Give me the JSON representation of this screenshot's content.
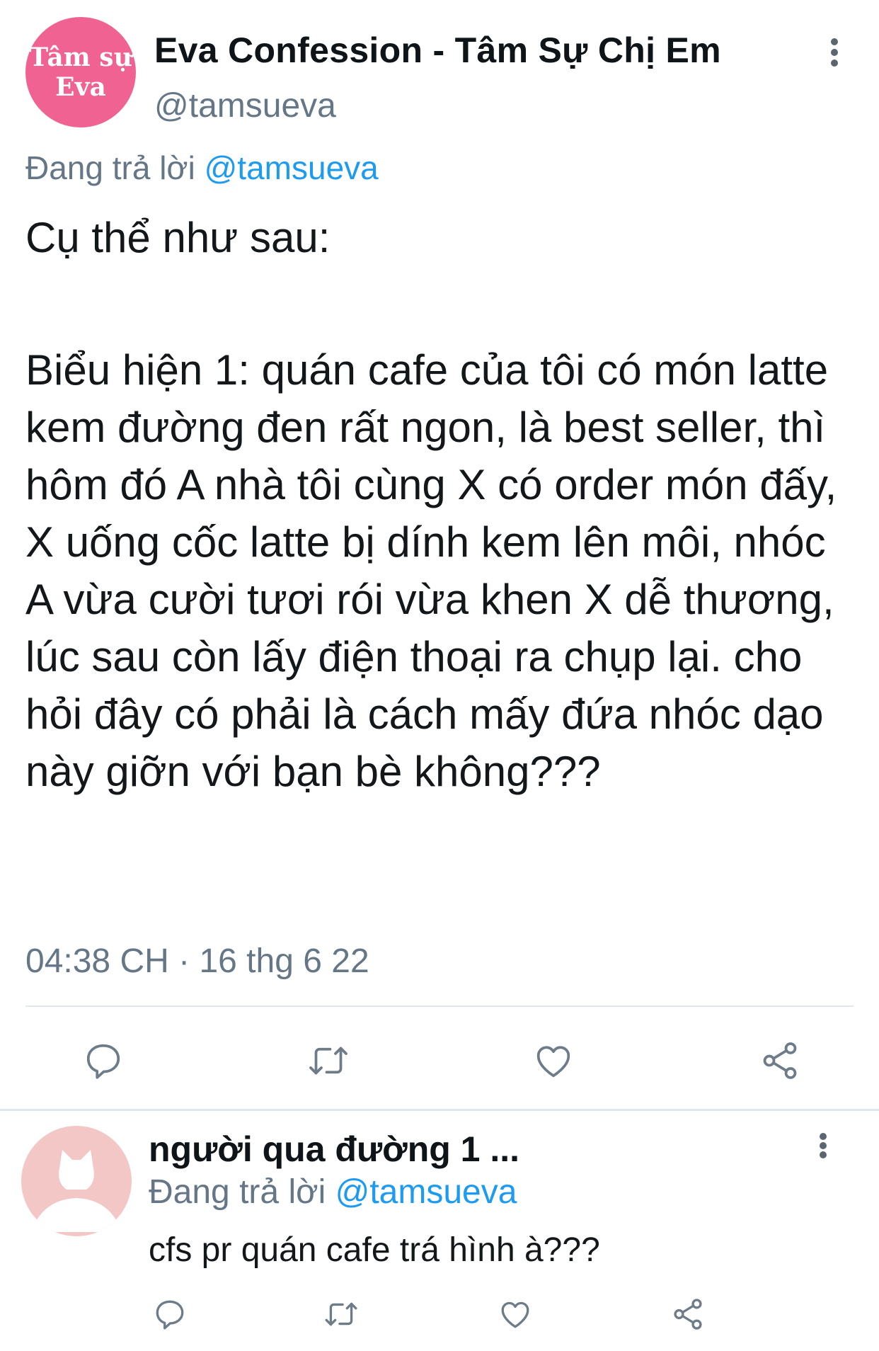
{
  "main_tweet": {
    "avatar_text_line1": "Tâm sự",
    "avatar_text_line2": "Eva",
    "display_name": "Eva Confession - Tâm Sự Chị Em",
    "handle": "@tamsueva",
    "replying_prefix": "Đang trả lời",
    "replying_to": "@tamsueva",
    "text_para1": "Cụ thể như sau:",
    "text_para2": "Biểu hiện 1: quán cafe của tôi có món latte kem đường đen rất ngon, là best seller, thì hôm đó A nhà tôi cùng X có order món đấy, X uống cốc latte bị dính kem lên môi, nhóc A vừa cười tươi rói vừa khen X dễ thương, lúc sau còn lấy điện thoại ra chụp lại. cho hỏi đây có phải là cách mấy đứa nhóc dạo này giỡn với bạn bè không???",
    "timestamp": "04:38 CH · 16 thg 6 22"
  },
  "reply_tweet": {
    "display_name": "người qua đường 1 ...",
    "replying_prefix": "Đang trả lời",
    "replying_to": "@tamsueva",
    "text": "cfs pr quán cafe trá hình à???"
  },
  "icons": {
    "more": "more-vertical-icon",
    "reply": "reply-icon",
    "retweet": "retweet-icon",
    "like": "like-icon",
    "share": "share-icon",
    "default_avatar": "default-avatar-icon"
  },
  "colors": {
    "text": "#14171a",
    "secondary": "#657786",
    "link": "#1d9bf0",
    "avatar_main": "#f06292",
    "avatar_reply": "#f4c7c7",
    "divider": "#e1e8ed"
  }
}
